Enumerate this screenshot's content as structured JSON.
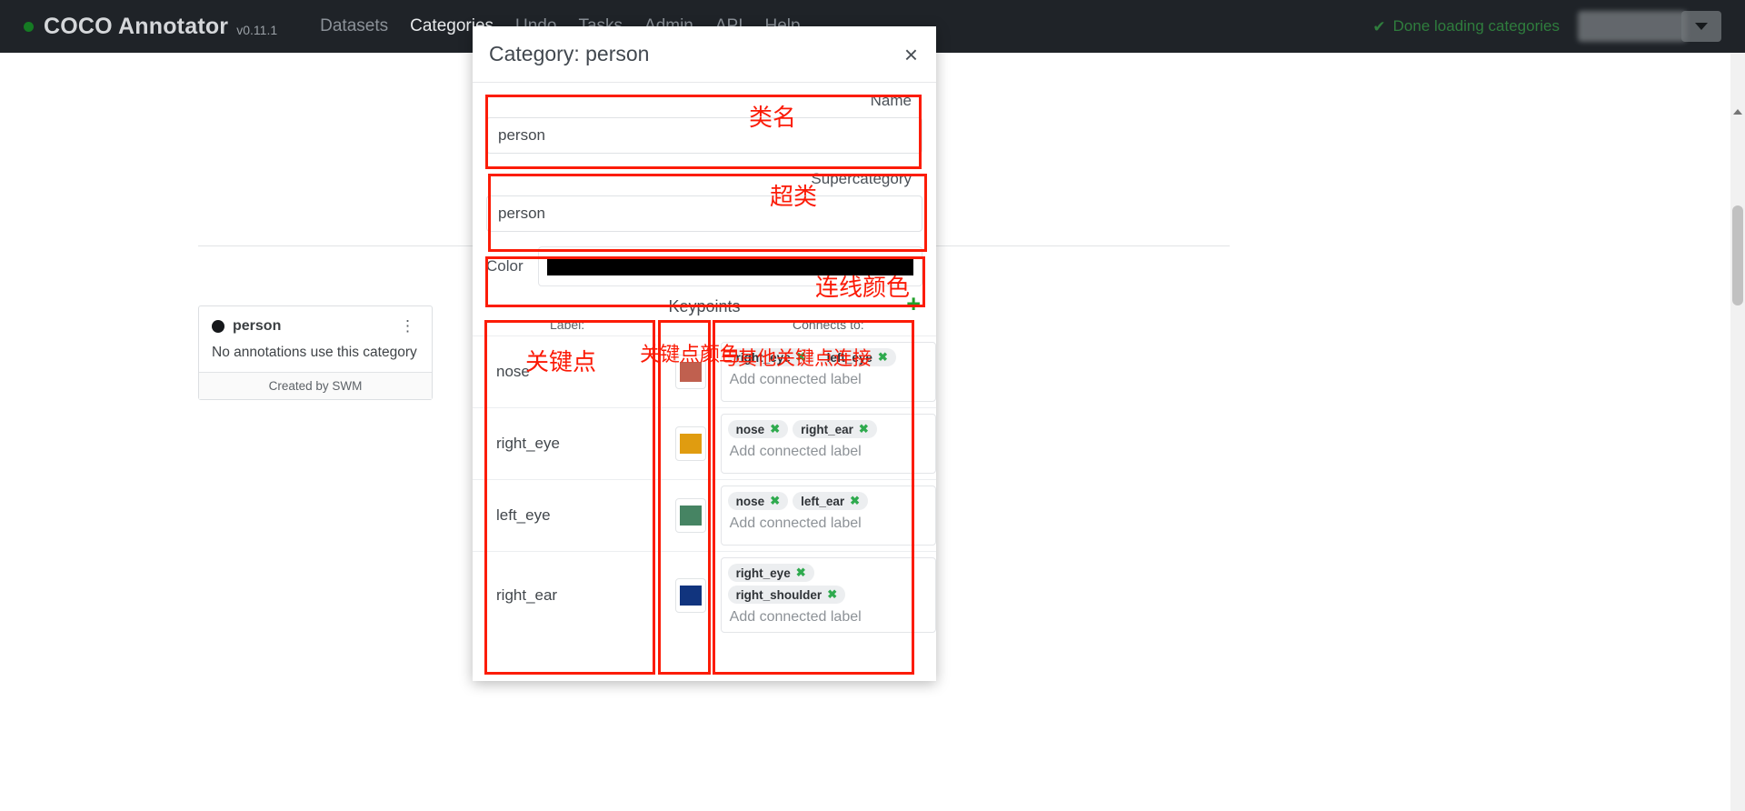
{
  "navbar": {
    "brand": "COCO Annotator",
    "version": "v0.11.1",
    "links": [
      {
        "label": "Datasets",
        "active": false
      },
      {
        "label": "Categories",
        "active": true
      },
      {
        "label": "Undo",
        "active": false
      },
      {
        "label": "Tasks",
        "active": false
      },
      {
        "label": "Admin",
        "active": false
      },
      {
        "label": "API",
        "active": false
      },
      {
        "label": "Help",
        "active": false
      }
    ],
    "status": "Done loading categories",
    "status_icon": "check-icon",
    "status_color": "#2f7d3d"
  },
  "background_page": {
    "category_card": {
      "title": "person",
      "swatch_color": "#16181b",
      "subtitle": "No annotations use this category",
      "footer": "Created by SWM",
      "menu_icon": "kebab-menu-icon"
    }
  },
  "modal": {
    "title": "Category: person",
    "close_icon": "close-icon",
    "name": {
      "label": "Name",
      "value": "person",
      "placeholder": "Name"
    },
    "supercategory": {
      "label": "Supercategory",
      "value": "person",
      "placeholder": "Supercategory"
    },
    "color": {
      "label": "Color",
      "value": "#000000"
    },
    "keypoints": {
      "title": "Keypoints",
      "add_icon": "plus-icon",
      "add_icon_color": "#22a02a",
      "columns": {
        "label": "Label:",
        "color": "",
        "connects": "Connects to:"
      },
      "add_connected_placeholder": "Add connected label",
      "rows": [
        {
          "label": "nose",
          "color": "#c0604f",
          "connects": [
            "right_eye",
            "left_eye"
          ]
        },
        {
          "label": "right_eye",
          "color": "#e09c10",
          "connects": [
            "nose",
            "right_ear"
          ]
        },
        {
          "label": "left_eye",
          "color": "#468463",
          "connects": [
            "nose",
            "left_ear"
          ]
        },
        {
          "label": "right_ear",
          "color": "#11347e",
          "connects": [
            "right_eye",
            "right_shoulder"
          ]
        }
      ]
    }
  },
  "annotations": {
    "color": "#fb1a06",
    "name_cn": "类名",
    "supercategory_cn": "超类",
    "color_cn": "连线颜色",
    "keypoint_label_cn": "关键点",
    "keypoint_color_cn": "关键点颜色",
    "connects_cn": "与其他关键点连接"
  }
}
